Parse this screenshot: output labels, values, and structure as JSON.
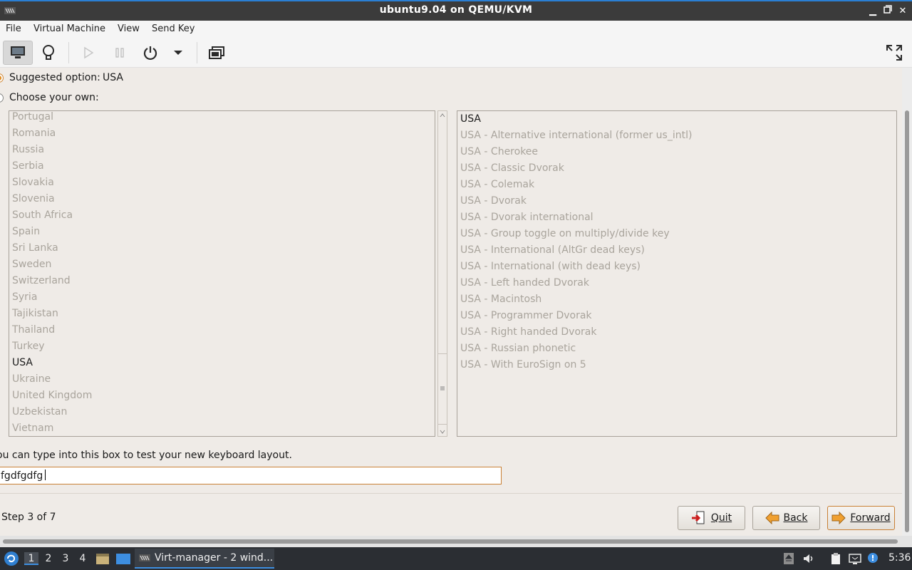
{
  "window": {
    "title": "ubuntu9.04 on QEMU/KVM"
  },
  "menu": {
    "items": [
      "File",
      "Virtual Machine",
      "View",
      "Send Key"
    ]
  },
  "installer": {
    "suggested_label": "Suggested option:",
    "suggested_value": "USA",
    "choose_label": "Choose your own:",
    "countries": [
      "Portugal",
      "Romania",
      "Russia",
      "Serbia",
      "Slovakia",
      "Slovenia",
      "South Africa",
      "Spain",
      "Sri Lanka",
      "Sweden",
      "Switzerland",
      "Syria",
      "Tajikistan",
      "Thailand",
      "Turkey",
      "USA",
      "Ukraine",
      "United Kingdom",
      "Uzbekistan",
      "Vietnam"
    ],
    "selected_country": "USA",
    "variants": [
      "USA",
      "USA - Alternative international (former us_intl)",
      "USA - Cherokee",
      "USA - Classic Dvorak",
      "USA - Colemak",
      "USA - Dvorak",
      "USA - Dvorak international",
      "USA - Group toggle on multiply/divide key",
      "USA - International (AltGr dead keys)",
      "USA - International (with dead keys)",
      "USA - Left handed Dvorak",
      "USA - Macintosh",
      "USA - Programmer Dvorak",
      "USA - Right handed Dvorak",
      "USA - Russian phonetic",
      "USA - With EuroSign on 5"
    ],
    "selected_variant": "USA",
    "test_hint": "ou can type into this box to test your new keyboard layout.",
    "test_value": "fgdfgdfg",
    "step": "Step 3 of 7",
    "buttons": {
      "quit": "Quit",
      "back": "Back",
      "forward": "Forward"
    }
  },
  "taskbar": {
    "workspaces": [
      "1",
      "2",
      "3",
      "4"
    ],
    "active_workspace": "1",
    "task_label": "Virt-manager - 2 wind...",
    "clock": "5:36"
  },
  "colors": {
    "accent": "#e08a1e",
    "taskbar": "#2b2e33",
    "titlebar": "#3b3b3b"
  }
}
